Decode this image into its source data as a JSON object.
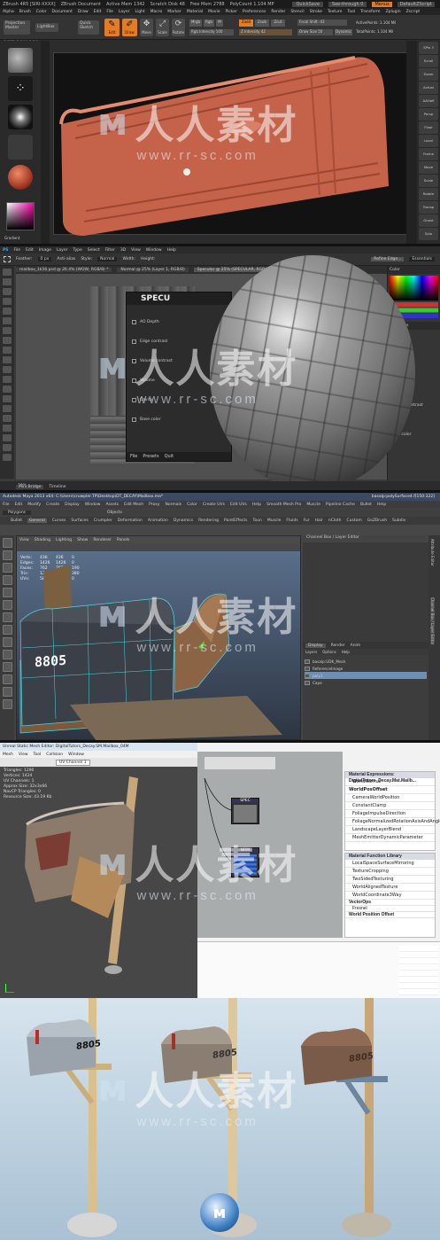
{
  "watermark": {
    "brand": "人人素材",
    "url": "www.rr-sc.com"
  },
  "zbrush": {
    "titlebar": [
      "ZBrush 4R5 [SIRI-XXXX]",
      "ZBrush Document",
      "Active Mem 1342",
      "Scratch Disk 48",
      "Free Mem 2788",
      "PolyCount 1.104 MP",
      "MeshCount 1"
    ],
    "title_buttons": {
      "quicksave": "QuickSave",
      "seethrough": "See-through 0",
      "menus": "Menus",
      "script": "DefaultZScript"
    },
    "menu": [
      "Alpha",
      "Brush",
      "Color",
      "Document",
      "Draw",
      "Edit",
      "File",
      "Layer",
      "Light",
      "Macro",
      "Marker",
      "Material",
      "Movie",
      "Picker",
      "Preferences",
      "Render",
      "Stencil",
      "Stroke",
      "Texture",
      "Tool",
      "Transform",
      "Zplugin",
      "Zscript"
    ],
    "shelf": {
      "projection": "Projection Master",
      "lightbox": "LightBox",
      "quicksketch": "Quick Sketch"
    },
    "modes": [
      "Edit",
      "Draw",
      "Move",
      "Scale",
      "Rotate"
    ],
    "options": {
      "mrgb": "Mrgb",
      "rgb": "Rgb",
      "m": "M",
      "zadd": "Zadd",
      "zsub": "Zsub",
      "zcut": "Zcut"
    },
    "intensity": "Z Intensity 42",
    "rgb_intensity": "Rgb Intensity 100",
    "focal": "Focal Shift -43",
    "drawsize": "Draw Size 50",
    "dynamic": "Dynamic",
    "stats": {
      "active": "ActivePoints: 1.104 Mil",
      "total": "TotalPoints: 1.104 Mil"
    },
    "coords": "0.382,0.044,0.16",
    "gradient": "Gradient",
    "switch": "SwitchColor",
    "right_tools": [
      "SPix 3",
      "Scroll",
      "Zoom",
      "Actual",
      "AAHalf",
      "Persp",
      "Floor",
      "Local",
      "Frame",
      "Move",
      "Scale",
      "Rotate",
      "Transp",
      "Ghost",
      "Solo"
    ],
    "colors": {
      "bg": "#2c2c2c",
      "canvas": "#121212",
      "mesh": "#c5634a",
      "accent": "#e47b26"
    }
  },
  "photoshop": {
    "menu": [
      "PS",
      "File",
      "Edit",
      "Image",
      "Layer",
      "Type",
      "Select",
      "Filter",
      "3D",
      "View",
      "Window",
      "Help"
    ],
    "tabs": [
      "mailbox_1k56.psd @ 26.4% (WOW, RGB/8) *",
      "Normal @ 25% (Layer 1, RGB/8)",
      "Specular @ 25% (SPECULAR, RGB/8)"
    ],
    "options": {
      "feather": "Feather:",
      "feather_value": "0 px",
      "antialias": "Anti-alias",
      "style": "Style:",
      "style_value": "Normal",
      "width": "Width:",
      "height": "Height:",
      "refine": "Refine Edge...",
      "essentials": "Essentials"
    },
    "dialog_title": "SPECU",
    "dialog_items": [
      "AO Depth",
      "Edge contrast",
      "Volume contrast",
      "Volume",
      "Cavity",
      "Base color"
    ],
    "dialog_buttons": [
      "File",
      "Presets",
      "Quit"
    ],
    "panel_labels": [
      "Color",
      "Swatches",
      "Volume contrast",
      "Volume",
      "Cavity",
      "Base color"
    ],
    "zoom": "29%",
    "bottom_tabs": [
      "Mini Bridge",
      "Timeline"
    ],
    "colors": {
      "bg": "#3a3a3a",
      "sphere": "#8a8a8a"
    }
  },
  "maya": {
    "title": "Autodesk Maya 2013 x64: C:\\Users\\cruwpler.TP\\Desktop\\DT_DECAY\\Mailbox.ma*",
    "title_right": "basalp:polySurface4.f[150:322]",
    "menu": [
      "File",
      "Edit",
      "Modify",
      "Create",
      "Display",
      "Window",
      "Assets",
      "Edit Mesh",
      "Proxy",
      "Normals",
      "Color",
      "Create UVs",
      "Edit UVs",
      "Help",
      "Smooth Mesh Pro",
      "Muscle",
      "Pipeline Cache",
      "Bullet",
      "Help"
    ],
    "mode": "Polygons",
    "objects": "Objects",
    "shelf_tabs": [
      "Bullet",
      "General",
      "Curves",
      "Surfaces",
      "Crumpler",
      "Deformation",
      "Animation",
      "Dynamics",
      "Rendering",
      "PaintEffects",
      "Toon",
      "Muscle",
      "Fluids",
      "Fur",
      "Hair",
      "nCloth",
      "Custom",
      "GoZBrush",
      "Subdiv"
    ],
    "panel_menu": [
      "View",
      "Shading",
      "Lighting",
      "Show",
      "Renderer",
      "Panels"
    ],
    "hud": [
      {
        "label": "Verts:",
        "a": "436",
        "b": "436",
        "c": "0"
      },
      {
        "label": "Edges:",
        "a": "1426",
        "b": "1426",
        "c": "0"
      },
      {
        "label": "Faces:",
        "a": "762",
        "b": "762",
        "c": "190"
      },
      {
        "label": "Tris:",
        "a": "1290",
        "b": "1290",
        "c": "380"
      },
      {
        "label": "UVs:",
        "a": "584",
        "b": "584",
        "c": "0"
      }
    ],
    "mailbox_number": "8805",
    "channel_box": "Channel Box / Layer Editor",
    "channel_tabs": [
      "Display",
      "Render",
      "Anim"
    ],
    "channel_sub": [
      "Layers",
      "Options",
      "Help"
    ],
    "layers": [
      "basalp:UDK_Mesh",
      "ReferenceImage",
      "poly1",
      "Cape"
    ],
    "side_tabs": [
      "Attribute Editor",
      "Channel Box / Layer Editor"
    ],
    "colors": {
      "bg": "#444444",
      "viewport_top": "#5d7390",
      "viewport_bottom": "#2d3542",
      "wire": "#4dd9e6"
    }
  },
  "unreal": {
    "title": "Unreal Static Mesh Editor: DigitalTutors_Decay.SM.Mailbox_04M",
    "menu": [
      "Mesh",
      "View",
      "Tool",
      "Collision",
      "Window"
    ],
    "uv_channel": "UV Channel 1",
    "stats": [
      "Triangles: 1290",
      "Vertices: 1424",
      "UV Channels: 1",
      "Approx Size: 32x3x66",
      "NavCP Triangles: 0",
      "Resource Size: 43.19 Kb"
    ],
    "graph_nodes": [
      "SPEC",
      "NRM"
    ],
    "expressions_title": "Material Expressions: DigitalTutors_Decay.Mat.Mailb...",
    "expressions": [
      "WorldNormal",
      "WorldPosOffset",
      "CameraWorldPosition",
      "ConstantClamp",
      "FoliageImpulseDirection",
      "FoliageNormalizedRotationAxisAndAngle",
      "LandscapeLayerBlend",
      "MeshEmitterDynamicParameter"
    ],
    "function_title": "Material Function Library",
    "functions": [
      "LocalSpaceSurfaceMirroring",
      "TextureCropping",
      "TwoSidedTexturing",
      "WorldAlignedTexture",
      "WorldCoordinate3Way"
    ],
    "function_groups": [
      "VectorOps",
      "Fresnel"
    ],
    "function_last": "World Position Offset",
    "colors": {
      "editor_bg": "#474747",
      "graph_bg": "#a9acad",
      "node": "#0b3f9d"
    }
  },
  "render": {
    "numbers": [
      "8805",
      "8805",
      "8805"
    ],
    "colors": {
      "sky": "#bcd2e3",
      "post": "#d3b581",
      "metal": "#9aa3ab"
    }
  }
}
